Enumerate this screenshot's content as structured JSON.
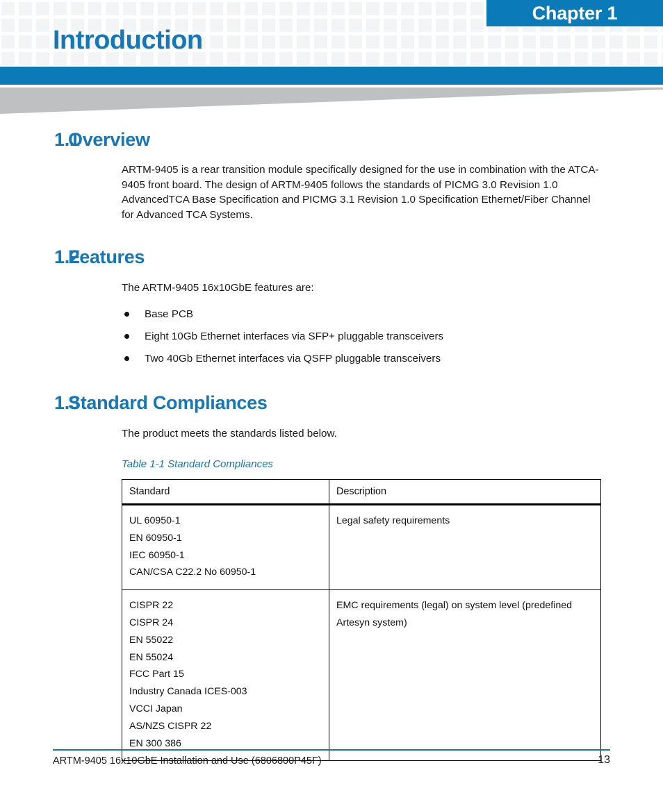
{
  "header": {
    "chapter_badge": "Chapter 1",
    "chapter_title": "Introduction",
    "accent_blue": "#1577b8",
    "bar_blue": "#0b7ab8",
    "wedge_gray": "#bfc0c2",
    "grid_cell_gray": "#f3f4f5"
  },
  "sections": [
    {
      "number": "1.1",
      "title": "Overview",
      "paragraph": "ARTM-9405 is a rear transition module specifically designed for the use in combination with the ATCA-9405 front board. The design of ARTM-9405 follows the standards of PICMG 3.0 Revision 1.0 AdvancedTCA Base Specification and PICMG 3.1 Revision 1.0 Specification Ethernet/Fiber Channel for Advanced TCA Systems."
    },
    {
      "number": "1.2",
      "title": "Features",
      "paragraph": "The ARTM-9405 16x10GbE features are:",
      "bullets": [
        "Base PCB",
        "Eight 10Gb Ethernet interfaces via SFP+ pluggable transceivers",
        "Two 40Gb Ethernet interfaces via QSFP pluggable transceivers"
      ]
    },
    {
      "number": "1.3",
      "title": "Standard Compliances",
      "paragraph": "The product meets the standards listed below."
    }
  ],
  "table": {
    "caption": "Table 1-1 Standard Compliances",
    "columns": [
      "Standard",
      "Description"
    ],
    "rows": [
      {
        "standard_lines": [
          "UL 60950-1",
          "EN 60950-1",
          "IEC 60950-1",
          "CAN/CSA C22.2 No 60950-1"
        ],
        "description_lines": [
          "Legal safety requirements"
        ]
      },
      {
        "standard_lines": [
          "CISPR 22",
          "CISPR 24",
          "EN 55022",
          "EN 55024",
          "FCC Part 15",
          "Industry Canada ICES-003",
          "VCCI Japan",
          "AS/NZS CISPR 22",
          "EN 300 386"
        ],
        "description_lines": [
          "EMC requirements (legal) on system level (predefined",
          "Artesyn system)"
        ]
      }
    ]
  },
  "footer": {
    "document_title": "ARTM-9405 16x10GbE Installation and Use (6806800P45F)",
    "page_number": "13"
  }
}
